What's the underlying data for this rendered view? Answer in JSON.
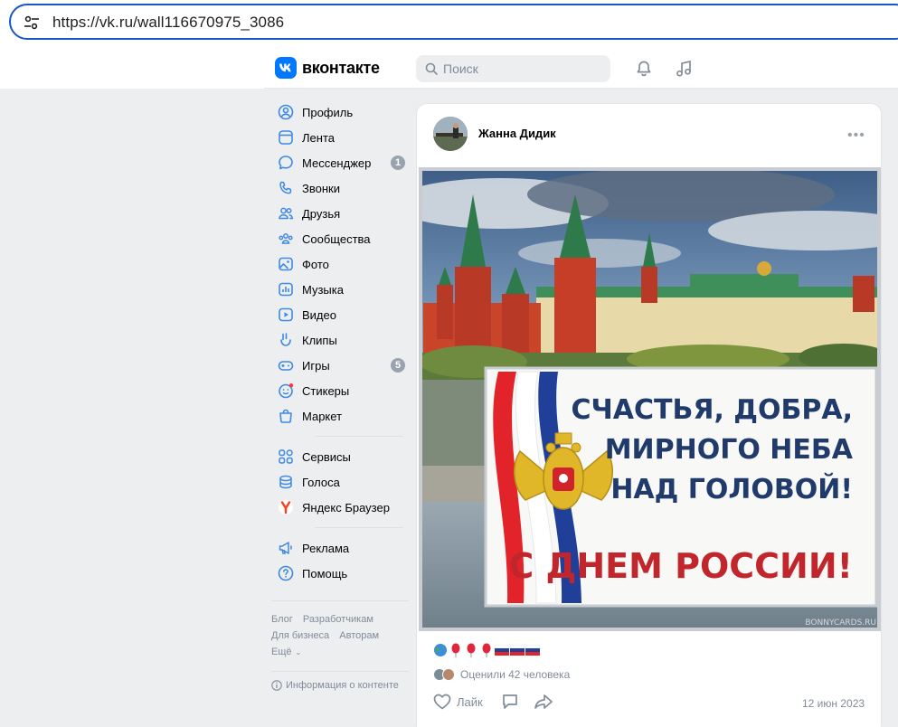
{
  "browser": {
    "url": "https://vk.ru/wall116670975_3086"
  },
  "header": {
    "logo_text": "вконтакте",
    "search_placeholder": "Поиск"
  },
  "sidebar": {
    "items": [
      {
        "label": "Профиль",
        "icon": "profile-icon"
      },
      {
        "label": "Лента",
        "icon": "feed-icon"
      },
      {
        "label": "Мессенджер",
        "icon": "messenger-icon",
        "badge": "1"
      },
      {
        "label": "Звонки",
        "icon": "phone-icon"
      },
      {
        "label": "Друзья",
        "icon": "friends-icon"
      },
      {
        "label": "Сообщества",
        "icon": "communities-icon"
      },
      {
        "label": "Фото",
        "icon": "photo-icon"
      },
      {
        "label": "Музыка",
        "icon": "music-icon"
      },
      {
        "label": "Видео",
        "icon": "video-icon"
      },
      {
        "label": "Клипы",
        "icon": "clips-icon"
      },
      {
        "label": "Игры",
        "icon": "games-icon",
        "badge": "5"
      },
      {
        "label": "Стикеры",
        "icon": "stickers-icon"
      },
      {
        "label": "Маркет",
        "icon": "market-icon"
      }
    ],
    "items2": [
      {
        "label": "Сервисы",
        "icon": "services-icon"
      },
      {
        "label": "Голоса",
        "icon": "votes-icon"
      },
      {
        "label": "Яндекс Браузер",
        "icon": "yandex-browser-icon"
      }
    ],
    "items3": [
      {
        "label": "Реклама",
        "icon": "ads-icon"
      },
      {
        "label": "Помощь",
        "icon": "help-icon"
      }
    ],
    "footer": {
      "blog": "Блог",
      "developers": "Разработчикам",
      "business": "Для бизнеса",
      "authors": "Авторам",
      "more": "Ещё"
    },
    "content_info": "Информация о контенте"
  },
  "post": {
    "author": "Жанна Дидик",
    "image_text": {
      "line1": "СЧАСТЬЯ, ДОБРА,",
      "line2": "МИРНОГО НЕБА",
      "line3": "НАД ГОЛОВОЙ!",
      "line4": "С ДНЕМ РОССИИ!",
      "watermark": "BONNYCARDS.RU"
    },
    "likes_text": "Оценили 42 человека",
    "like_label": "Лайк",
    "date": "12 июн 2023"
  },
  "colors": {
    "accent": "#0077ff",
    "badge": "#99a2ad",
    "muted": "#818c99",
    "card_blue": "#1f3a6b",
    "card_red": "#c0262c"
  }
}
